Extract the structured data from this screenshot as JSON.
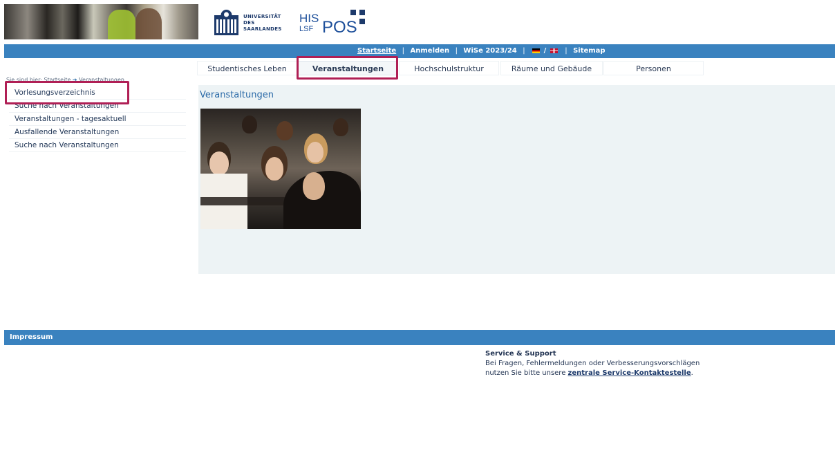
{
  "header": {
    "uni_logo_lines": [
      "UNIVERSITÄT",
      "DES",
      "SAARLANDES"
    ],
    "his_line1": "HIS",
    "his_line2": "LSF",
    "his_pos": "POS"
  },
  "topbar": {
    "startseite": "Startseite",
    "anmelden": "Anmelden",
    "semester": "WiSe 2023/24",
    "sitemap": "Sitemap"
  },
  "tabs": [
    {
      "label": "Studentisches Leben"
    },
    {
      "label": "Veranstaltungen",
      "active": true
    },
    {
      "label": "Hochschulstruktur"
    },
    {
      "label": "Räume und Gebäude"
    },
    {
      "label": "Personen"
    }
  ],
  "breadcrumb": {
    "prefix": "Sie sind hier:",
    "home": "Startseite",
    "current": "Veranstaltungen"
  },
  "sidebar": {
    "items": [
      {
        "label": "Vorlesungsverzeichnis"
      },
      {
        "label": "Suche nach Veranstaltungen"
      },
      {
        "label": "Veranstaltungen - tagesaktuell"
      },
      {
        "label": "Ausfallende Veranstaltungen"
      },
      {
        "label": "Suche nach Veranstaltungen"
      }
    ]
  },
  "content": {
    "title": "Veranstaltungen"
  },
  "footer": {
    "impressum": "Impressum",
    "service_title": "Service & Support",
    "service_line1": "Bei Fragen, Fehlermeldungen oder Verbesserungsvorschlägen",
    "service_line2_prefix": "nutzen Sie bitte unsere",
    "service_link": "zentrale Service-Kontaktestelle",
    "service_suffix": "."
  },
  "colors": {
    "bar_blue": "#3a82bf",
    "highlight": "#b01f55",
    "content_bg": "#edf3f5",
    "title_blue": "#2b6aa8"
  }
}
